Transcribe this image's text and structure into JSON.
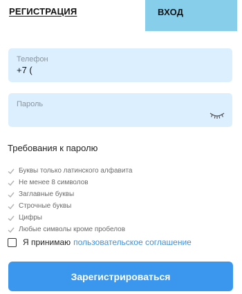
{
  "tabs": {
    "register": "РЕГИСТРАЦИЯ",
    "login": "ВХОД"
  },
  "phone": {
    "label": "Телефон",
    "value": "+7 ("
  },
  "password": {
    "label": "Пароль",
    "toggle_icon": "eye-closed-icon"
  },
  "requirements": {
    "title": "Требования к паролю",
    "items": [
      "Буквы только латинского алфавита",
      "Не менее 8 символов",
      "Заглавные буквы",
      "Строчные буквы",
      "Цифры",
      "Любые символы кроме пробелов"
    ]
  },
  "agreement": {
    "text": "Я принимаю",
    "link": "пользовательское соглашение"
  },
  "submit_label": "Зарегистрироваться",
  "colors": {
    "login_tab_bg": "#87ceeb",
    "field_bg": "#dcefff",
    "accent": "#3b97ee",
    "link": "#3d8fe0"
  }
}
